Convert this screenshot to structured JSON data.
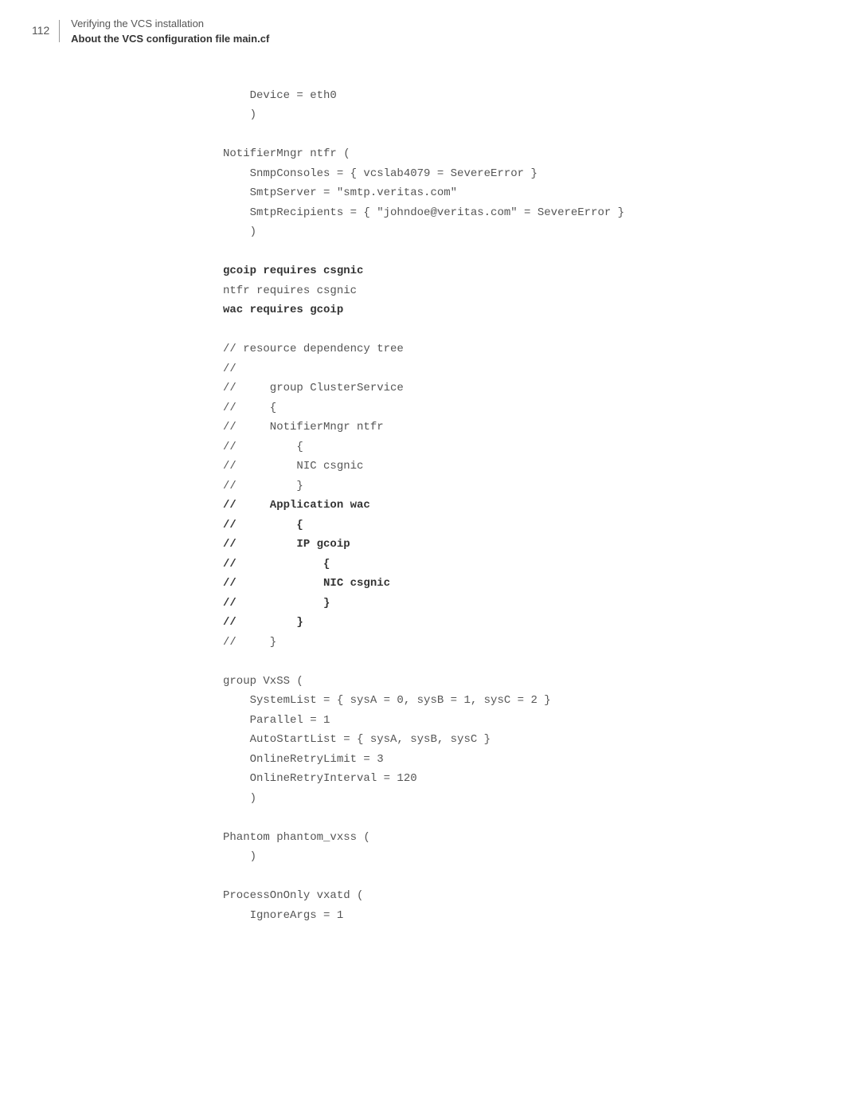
{
  "header": {
    "page_number": "112",
    "title": "Verifying the VCS installation",
    "subtitle": "About the VCS configuration file main.cf"
  },
  "code": {
    "l01": "    Device = eth0",
    "l02": "    )",
    "l03": "",
    "l04": "NotifierMngr ntfr (",
    "l05": "    SnmpConsoles = { vcslab4079 = SevereError }",
    "l06": "    SmtpServer = \"smtp.veritas.com\"",
    "l07": "    SmtpRecipients = { \"johndoe@veritas.com\" = SevereError }",
    "l08": "    )",
    "l09": "",
    "l10": "gcoip requires csgnic",
    "l11": "ntfr requires csgnic",
    "l12": "wac requires gcoip",
    "l13": "",
    "l14": "// resource dependency tree",
    "l15": "//",
    "l16": "//     group ClusterService",
    "l17": "//     {",
    "l18": "//     NotifierMngr ntfr",
    "l19": "//         {",
    "l20": "//         NIC csgnic",
    "l21": "//         }",
    "l22": "//     Application wac",
    "l23": "//         {",
    "l24": "//         IP gcoip",
    "l25": "//             {",
    "l26": "//             NIC csgnic",
    "l27": "//             }",
    "l28": "//         }",
    "l29": "//     }",
    "l30": "",
    "l31": "group VxSS (",
    "l32": "    SystemList = { sysA = 0, sysB = 1, sysC = 2 }",
    "l33": "    Parallel = 1",
    "l34": "    AutoStartList = { sysA, sysB, sysC }",
    "l35": "    OnlineRetryLimit = 3",
    "l36": "    OnlineRetryInterval = 120",
    "l37": "    )",
    "l38": "",
    "l39": "Phantom phantom_vxss (",
    "l40": "    )",
    "l41": "",
    "l42": "ProcessOnOnly vxatd (",
    "l43": "    IgnoreArgs = 1"
  }
}
